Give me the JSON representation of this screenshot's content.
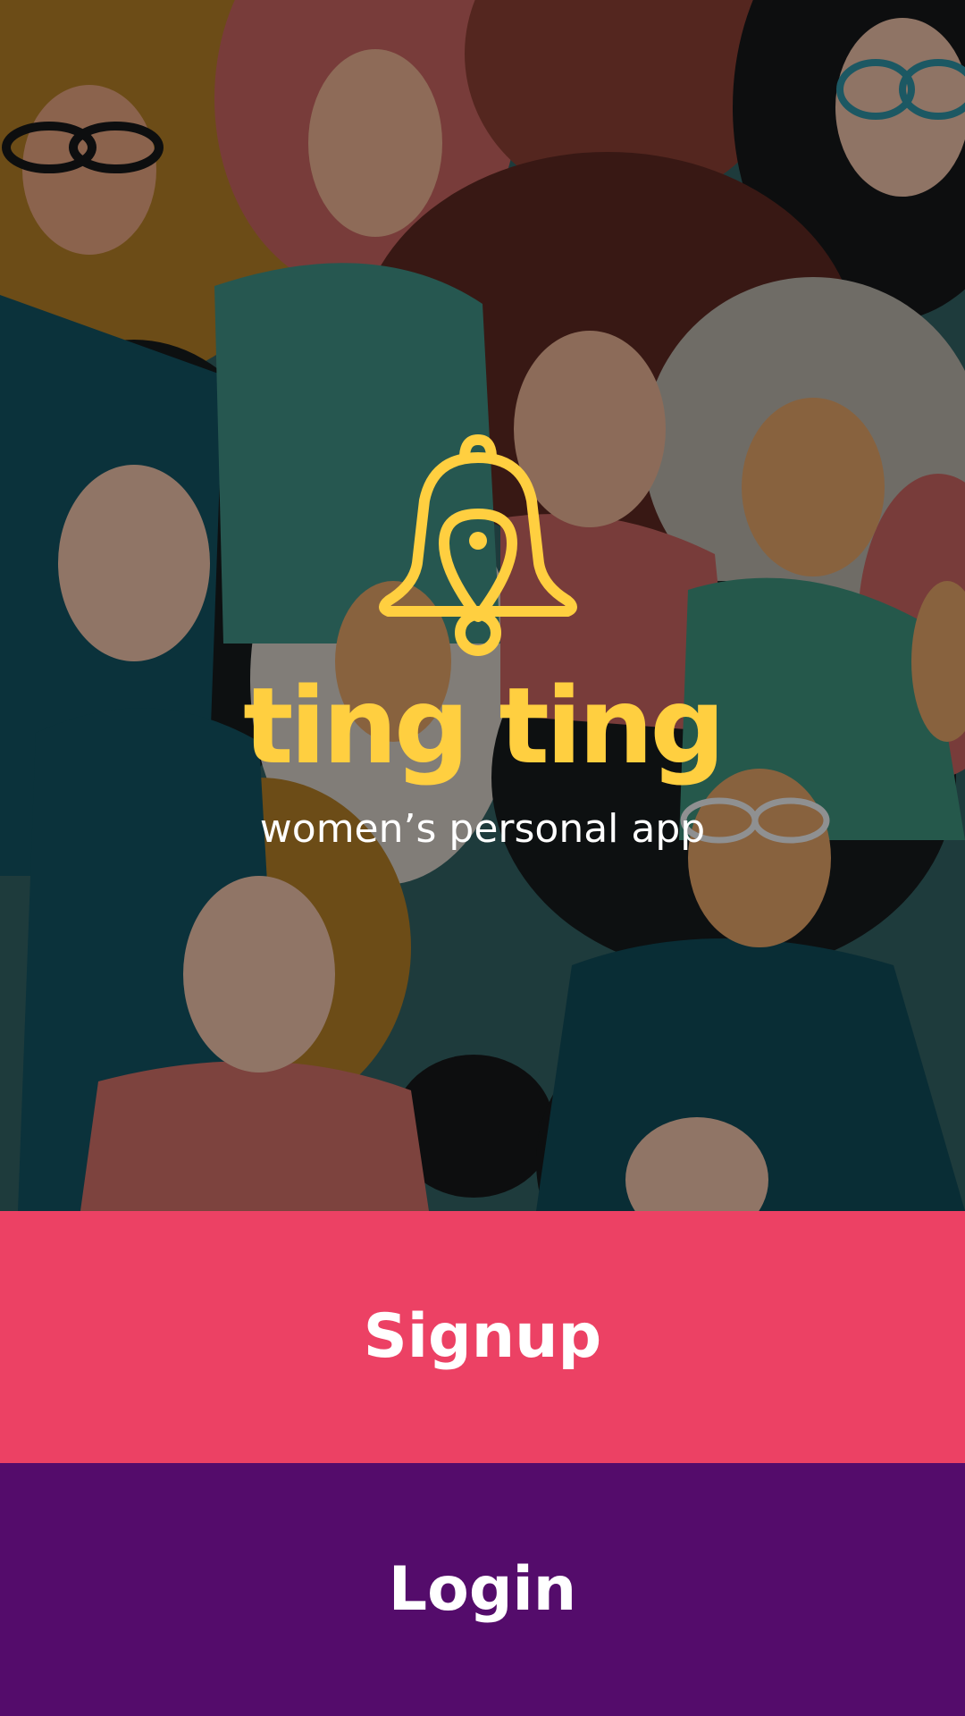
{
  "app": {
    "name": "ting ting",
    "tagline": "women’s personal app",
    "logo_icon": "bell-location-pin-icon"
  },
  "actions": {
    "signup_label": "Signup",
    "login_label": "Login"
  },
  "colors": {
    "brand_yellow": "#ffcf40",
    "signup_background": "#ec4164",
    "login_background": "#540c6b",
    "text_on_buttons": "#ffffff"
  },
  "background": {
    "illustration": "crowd-of-women-illustration"
  }
}
